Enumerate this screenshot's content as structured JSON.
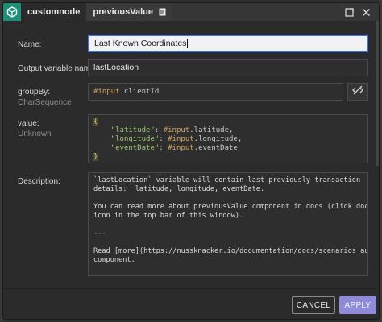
{
  "titlebar": {
    "node_type": "customnode",
    "component": "previousValue",
    "icons": [
      "node-type-icon",
      "docs-icon",
      "maximize-icon",
      "close-icon"
    ]
  },
  "form": {
    "name": {
      "label": "Name:",
      "value": "Last Known Coordinates"
    },
    "output_variable": {
      "label": "Output variable name:",
      "value": "lastLocation"
    },
    "group_by": {
      "label": "groupBy:",
      "type": "CharSequence",
      "value_parts": [
        "#input",
        ".clientId"
      ]
    },
    "value": {
      "label": "value:",
      "type": "Unknown",
      "lines": [
        {
          "key": "\"latitude\"",
          "sep": ": ",
          "ref": "#input",
          "prop": ".latitude,"
        },
        {
          "key": "\"longitude\"",
          "sep": ": ",
          "ref": "#input",
          "prop": ".longitude,"
        },
        {
          "key": "\"eventDate\"",
          "sep": ": ",
          "ref": "#input",
          "prop": ".eventDate"
        }
      ],
      "open_brace": "{",
      "close_brace": "}"
    },
    "description": {
      "label": "Description:",
      "text": "`lastLocation` variable will contain last previously transaction\ndetails:  latitude, longitude, eventDate.\n\nYou can read more about previousValue component in docs (click docs\nicon in the top bar of this window).\n\n---\n\nRead [more](https://nussknacker.io/documentation/docs/scenarios_authoring/DataSourcesAndSinks/#previousvalue) about previous value\ncomponent."
    }
  },
  "footer": {
    "cancel_label": "CANCEL",
    "apply_label": "APPLY"
  },
  "colors": {
    "accent": "#8f8bd8",
    "node_icon": "#1e8e76",
    "focus": "#4a6fd1"
  }
}
